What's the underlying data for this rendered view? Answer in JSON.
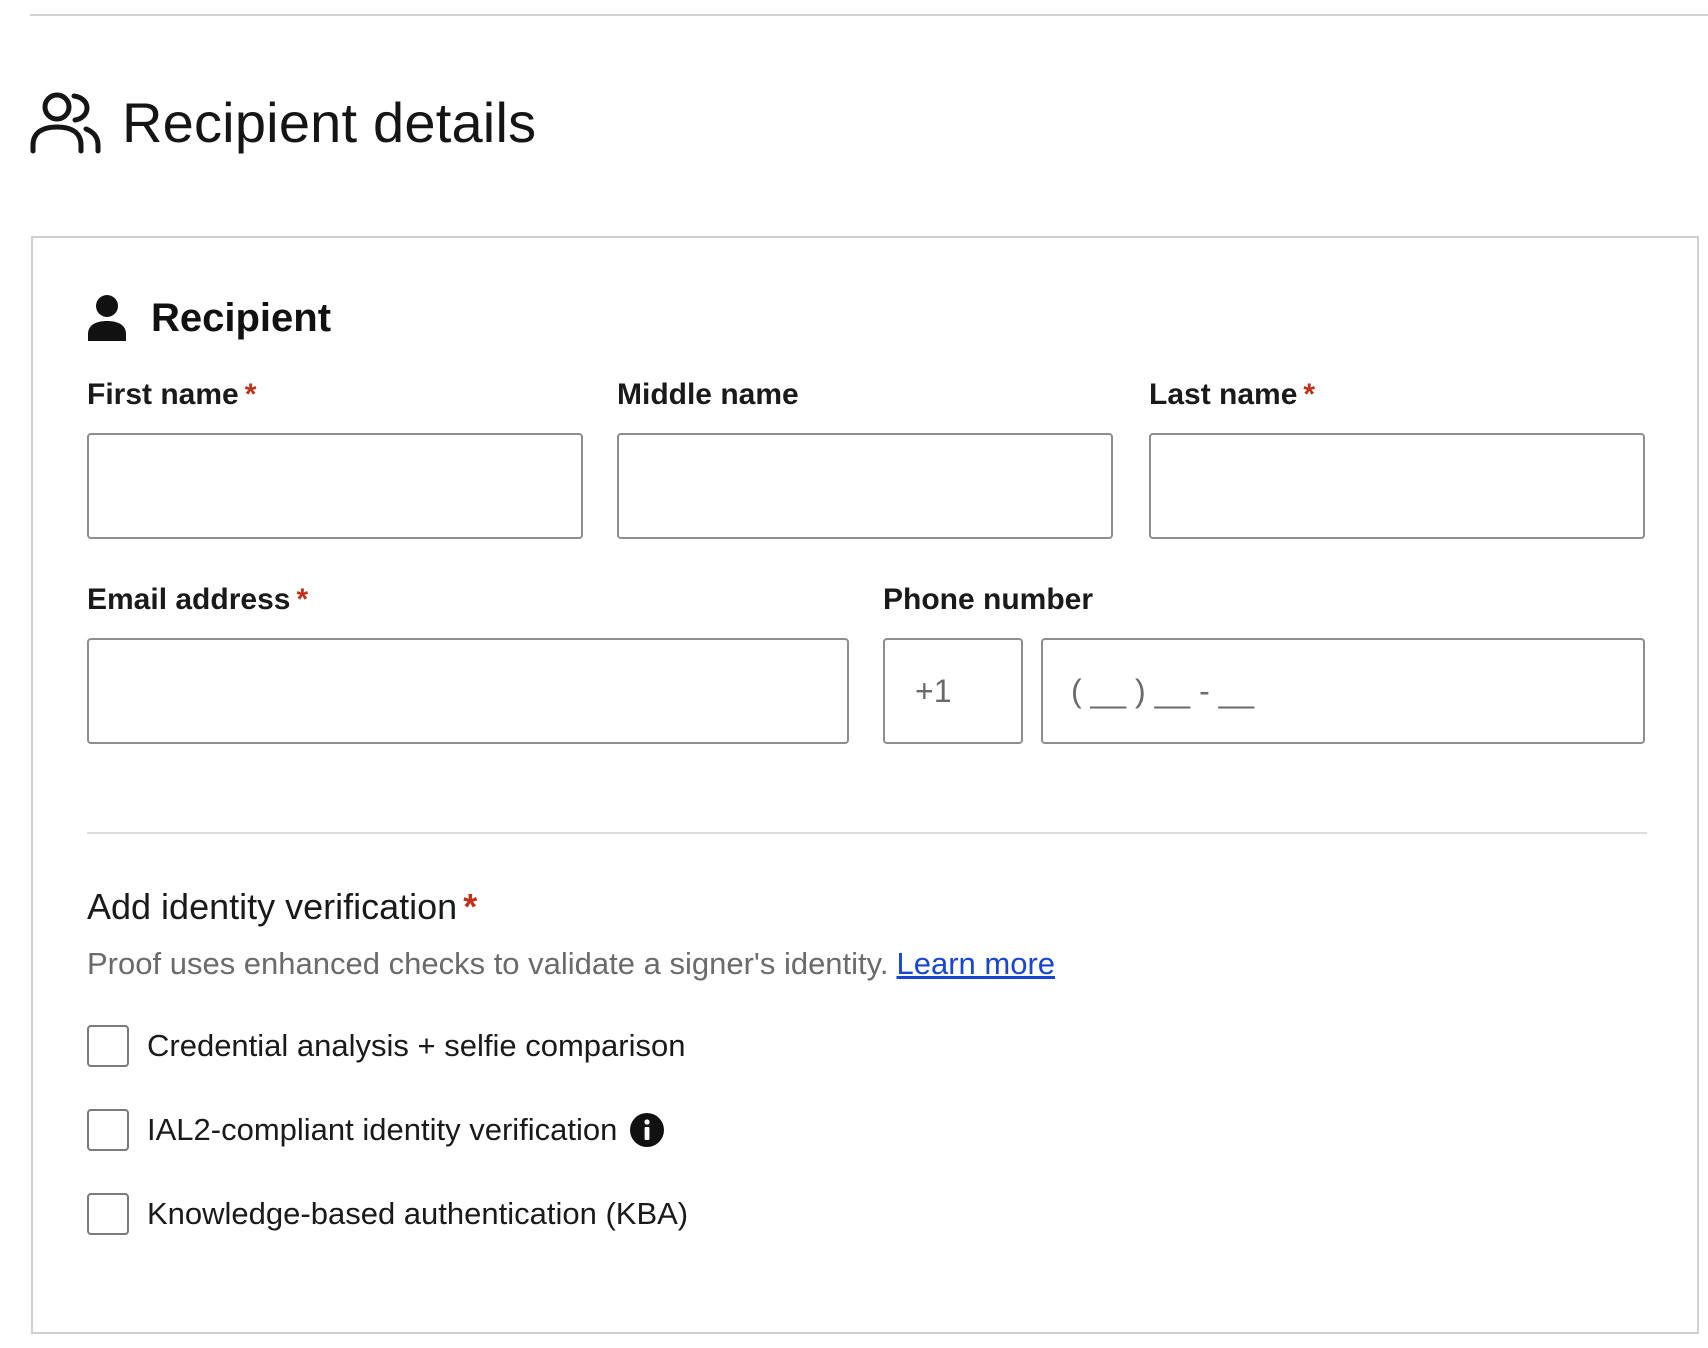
{
  "section": {
    "title": "Recipient details"
  },
  "card": {
    "title": "Recipient"
  },
  "fields": {
    "first_name": {
      "label": "First name",
      "required_mark": "*",
      "value": ""
    },
    "middle_name": {
      "label": "Middle name",
      "value": ""
    },
    "last_name": {
      "label": "Last name",
      "required_mark": "*",
      "value": ""
    },
    "email": {
      "label": "Email address",
      "required_mark": "*",
      "value": ""
    },
    "phone": {
      "label": "Phone number",
      "country_code": "+1",
      "placeholder": "( __ ) __ - __"
    }
  },
  "identity_verification": {
    "heading": "Add identity verification",
    "required_mark": "*",
    "description": "Proof uses enhanced checks to validate a signer's identity.",
    "learn_more": "Learn more",
    "options": [
      {
        "label": "Credential analysis + selfie comparison",
        "checked": false
      },
      {
        "label": "IAL2-compliant identity verification",
        "checked": false,
        "icon": "info-icon"
      },
      {
        "label": "Knowledge-based authentication (KBA)",
        "checked": false
      }
    ]
  },
  "colors": {
    "required": "#c0311b",
    "link": "#1746d6",
    "border": "#8e8e8e"
  }
}
